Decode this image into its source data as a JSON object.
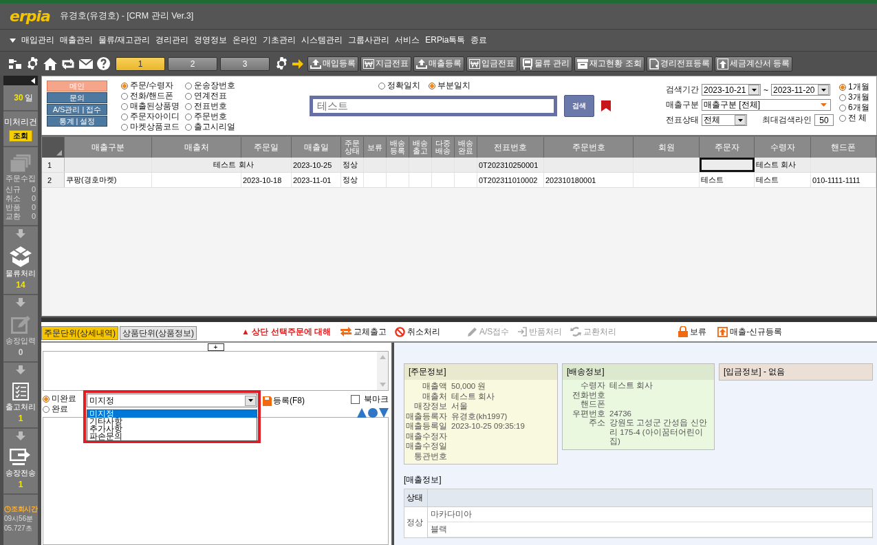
{
  "window": {
    "logo": "erpia",
    "title": "유경호(유경호) - [CRM 관리 Ver.3]"
  },
  "menu": [
    "매입관리",
    "매출관리",
    "물류/재고관리",
    "경리관리",
    "경영정보",
    "온라인",
    "기초관리",
    "시스템관리",
    "그룹사관리",
    "서비스",
    "ERPia톡톡",
    "종료"
  ],
  "toolbar": {
    "tabs": [
      {
        "label": "1",
        "selected": true
      },
      {
        "label": "2",
        "selected": false
      },
      {
        "label": "3",
        "selected": false
      }
    ],
    "buttons": [
      {
        "label": "매입등록",
        "kind": "upload"
      },
      {
        "label": "지급전표",
        "kind": "won"
      },
      {
        "label": "매출등록",
        "kind": "upload"
      },
      {
        "label": "입금전표",
        "kind": "won"
      },
      {
        "label": "물류 관리",
        "kind": "bus"
      },
      {
        "label": "재고현황 조회",
        "kind": "archive"
      },
      {
        "label": "경리전표등록",
        "kind": "document"
      },
      {
        "label": "세금계산서 등록",
        "kind": "export"
      }
    ]
  },
  "sidebar": {
    "period": {
      "value": "30",
      "unit": "일"
    },
    "pending": {
      "label": "미처리건",
      "button": "조회"
    },
    "steps": [
      {
        "kind": "collect",
        "label": "주문수집",
        "disabled": true,
        "counts": [
          {
            "label": "신규",
            "value": "0"
          },
          {
            "label": "취소",
            "value": "0"
          },
          {
            "label": "반품",
            "value": "0"
          },
          {
            "label": "교환",
            "value": "0"
          }
        ]
      },
      {
        "kind": "box",
        "label": "물류처리",
        "count": "14",
        "disabled": false
      },
      {
        "kind": "invoice",
        "label": "송장입력",
        "count": "0",
        "disabled": true
      },
      {
        "kind": "checklist",
        "label": "출고처리",
        "count": "1",
        "disabled": false
      },
      {
        "kind": "send",
        "label": "송장전송",
        "count": "1",
        "disabled": false
      }
    ],
    "query_time": {
      "label": "조회시간",
      "lines": [
        "09시56분",
        "05.727초"
      ]
    }
  },
  "search": {
    "modes": [
      {
        "label": "메인",
        "selected": true
      },
      {
        "label": "문의",
        "selected": false
      },
      {
        "label": "A/S관리 | 접수",
        "selected": false
      },
      {
        "label": "통계 | 설정",
        "selected": false
      }
    ],
    "search_by": [
      {
        "label": "주문/수령자",
        "selected": true
      },
      {
        "label": "전화/핸드폰",
        "selected": false
      },
      {
        "label": "매출된상품명",
        "selected": false
      },
      {
        "label": "주문자아이디",
        "selected": false
      },
      {
        "label": "마켓상품코드",
        "selected": false
      },
      {
        "label": "운송장번호",
        "selected": false
      },
      {
        "label": "연계전표",
        "selected": false
      },
      {
        "label": "전표번호",
        "selected": false
      },
      {
        "label": "주문번호",
        "selected": false
      },
      {
        "label": "출고시리얼",
        "selected": false
      }
    ],
    "match": [
      {
        "label": "정확일치",
        "selected": false
      },
      {
        "label": "부분일치",
        "selected": true
      }
    ],
    "query": "테스트",
    "search_button": "검색",
    "period": {
      "label": "검색기간",
      "from": "2023-10-21",
      "separator": "~",
      "to": "2023-11-20"
    },
    "sales_type": {
      "label": "매출구분",
      "value": "매출구분 [전체]"
    },
    "slip_status": {
      "label": "전표상태",
      "value": "전체"
    },
    "max_lines": {
      "label": "최대검색라인",
      "value": "50"
    },
    "ranges": [
      {
        "label": "1개월",
        "selected": true
      },
      {
        "label": "3개월",
        "selected": false
      },
      {
        "label": "6개월",
        "selected": false
      },
      {
        "label": "전 체",
        "selected": false
      }
    ]
  },
  "table": {
    "columns": [
      "매출구분",
      "매출처",
      "주문일",
      "매출일",
      "주문상태",
      "보류",
      "배송등록",
      "배송출고",
      "다중배송",
      "배송완료",
      "전표번호",
      "주문번호",
      "회원",
      "주문자",
      "수령자",
      "핸드폰"
    ],
    "rows": [
      {
        "number": "1",
        "selected": true,
        "cells": [
          null,
          "테스트 회사",
          null,
          "2023-10-25",
          "정상",
          null,
          null,
          null,
          null,
          null,
          "0T202310250001",
          null,
          null,
          {
            "focused": true
          },
          "테스트 회사",
          null
        ]
      },
      {
        "number": "2",
        "selected": false,
        "cells": [
          "쿠팡(경호마켓)",
          null,
          "2023-10-18",
          "2023-11-01",
          "정상",
          null,
          null,
          null,
          null,
          null,
          "0T202311010002",
          "202310180001",
          null,
          "테스트",
          "테스트",
          "010-1111-1111"
        ]
      }
    ]
  },
  "detail": {
    "tabs": [
      {
        "label": "주문단위(상세내역)",
        "selected": true
      },
      {
        "label": "상품단위(상품정보)",
        "selected": false
      }
    ],
    "notice": "▲ 상단 선택주문에 대해",
    "actions": [
      {
        "label": "교체출고",
        "kind": "swap",
        "disabled": false
      },
      {
        "label": "취소처리",
        "kind": "cancel",
        "disabled": false
      },
      {
        "label": "A/S접수",
        "kind": "pencil",
        "disabled": true
      },
      {
        "label": "반품처리",
        "kind": "return",
        "disabled": true
      },
      {
        "label": "교환처리",
        "kind": "exchange",
        "disabled": true
      }
    ],
    "right_actions": [
      {
        "label": "보류",
        "kind": "lock",
        "disabled": false
      },
      {
        "label": "매출-신규등록",
        "kind": "new",
        "disabled": false
      }
    ]
  },
  "memo": {
    "expand_button": "+",
    "completion": [
      {
        "label": "미완료",
        "selected": true
      },
      {
        "label": "완료",
        "selected": false
      }
    ],
    "category": {
      "value": "미지정",
      "expanded": true,
      "options": [
        {
          "label": "미지정",
          "selected": true
        },
        {
          "label": "기타사항",
          "selected": false
        },
        {
          "label": "추가사항",
          "selected": false
        },
        {
          "label": "파손문의",
          "selected": false
        }
      ]
    },
    "save_button": "등록(F8)",
    "bookmark": {
      "label": "북마크",
      "checked": false
    }
  },
  "order_info": {
    "title": "[주문정보]",
    "fields": [
      {
        "label": "매출액",
        "value": "50,000 원"
      },
      {
        "label": "매출처",
        "value": "테스트 회사"
      },
      {
        "label": "매장정보",
        "value": "서울"
      },
      {
        "label": "매출등록자",
        "value": "유경호(kh1997)"
      },
      {
        "label": "매출등록일",
        "value": "2023-10-25 09:35:19"
      },
      {
        "label": "매출수정자"
      },
      {
        "label": "매출수정일"
      },
      {
        "label": "통관번호"
      }
    ]
  },
  "shipping_info": {
    "title": "[배송정보]",
    "fields": [
      {
        "label": "수령자",
        "value": "테스트 회사"
      },
      {
        "label": "전화번호"
      },
      {
        "label": "핸드폰"
      },
      {
        "label": "우편번호",
        "value": "24736"
      },
      {
        "label": "주소",
        "value": "강원도 고성군 간성읍 신안리 175-4 (아이꿈터어린이집)"
      }
    ]
  },
  "payment_info": {
    "title": "[입금정보] - 없음"
  },
  "sales_info": {
    "title": "[매출정보]",
    "header": "상태",
    "status": "정상",
    "items": [
      "마카다미아",
      "블랙"
    ]
  }
}
